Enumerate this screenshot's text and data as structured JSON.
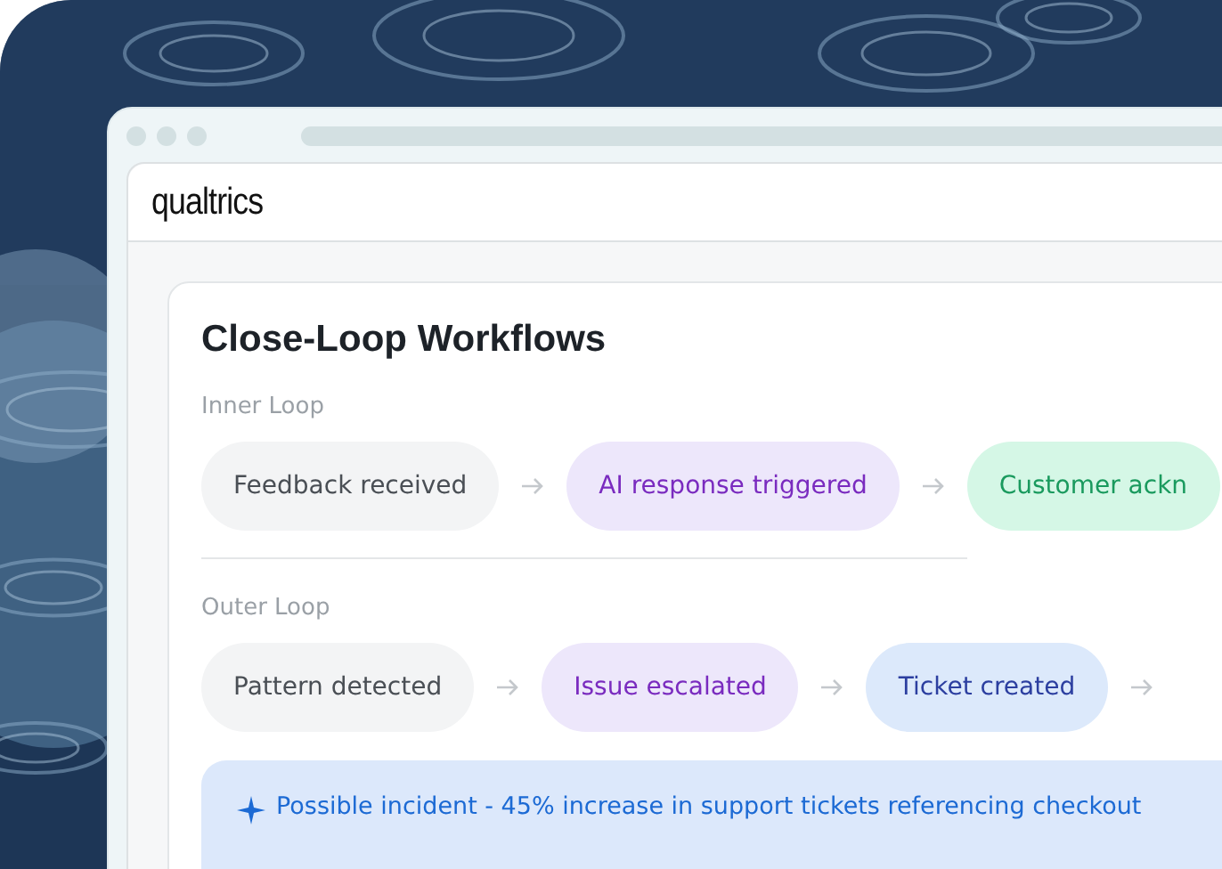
{
  "brand": "qualtrics",
  "card": {
    "title": "Close-Loop Workflows",
    "sections": [
      {
        "label": "Inner Loop",
        "steps": [
          {
            "label": "Feedback received",
            "kind": "neutral"
          },
          {
            "label": "AI response triggered",
            "kind": "purple"
          },
          {
            "label": "Customer ackn",
            "kind": "green"
          }
        ]
      },
      {
        "label": "Outer Loop",
        "steps": [
          {
            "label": "Pattern detected",
            "kind": "neutral"
          },
          {
            "label": "Issue escalated",
            "kind": "purple"
          },
          {
            "label": "Ticket created",
            "kind": "blue"
          }
        ],
        "trailing_arrow": true
      }
    ],
    "alert": "Possible incident - 45% increase in support tickets referencing checkout"
  }
}
